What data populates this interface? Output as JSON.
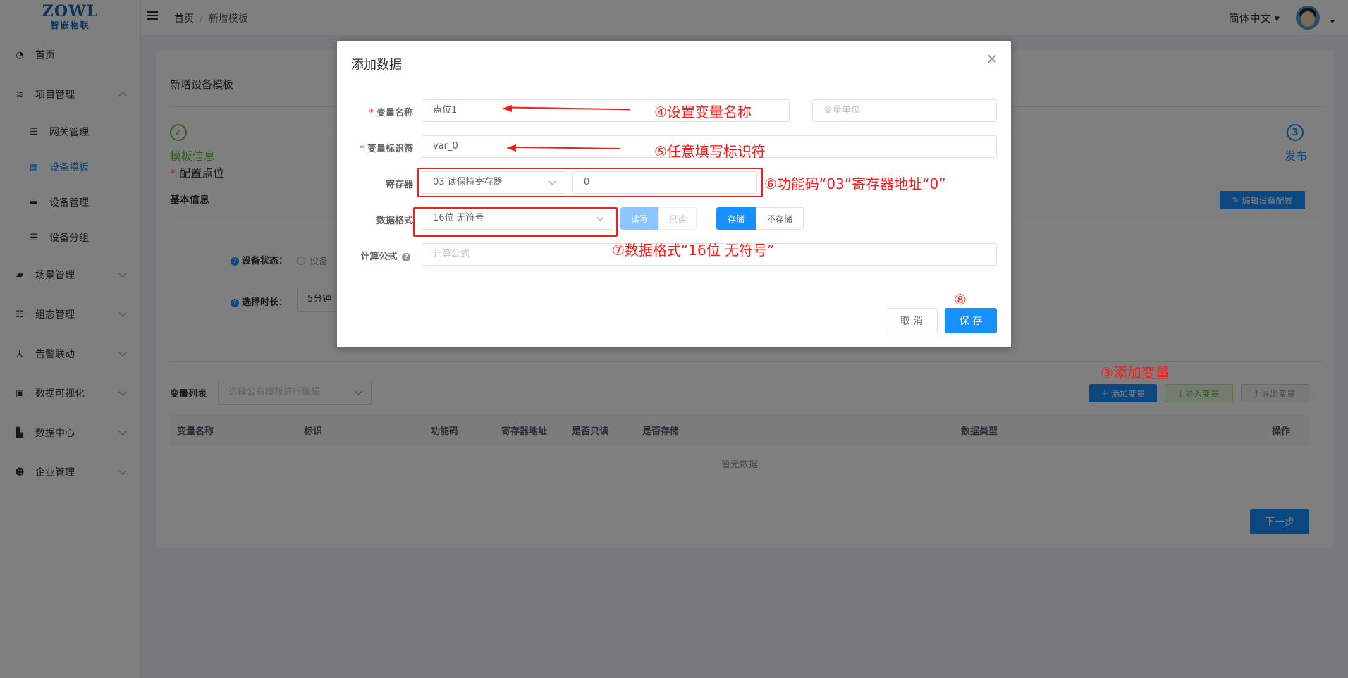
{
  "logo": {
    "brand": "ZOWL",
    "sub": "智嵌物联"
  },
  "sidebar": {
    "items": [
      {
        "label": "首页",
        "icon": "dashboard-icon"
      },
      {
        "label": "项目管理",
        "icon": "layers-icon"
      },
      {
        "label": "网关管理",
        "icon": "list-icon"
      },
      {
        "label": "设备模板",
        "icon": "grid-icon"
      },
      {
        "label": "设备管理",
        "icon": "server-icon"
      },
      {
        "label": "设备分组",
        "icon": "list-icon"
      },
      {
        "label": "场景管理",
        "icon": "clapper-icon"
      },
      {
        "label": "组态管理",
        "icon": "list-icon"
      },
      {
        "label": "告警联动",
        "icon": "share-icon"
      },
      {
        "label": "数据可视化",
        "icon": "monitor-icon"
      },
      {
        "label": "数据中心",
        "icon": "bar-chart-icon"
      },
      {
        "label": "企业管理",
        "icon": "user-gear-icon"
      }
    ]
  },
  "header": {
    "breadcrumb": [
      "首页",
      "新增模板"
    ],
    "language": "简体中文"
  },
  "main": {
    "title": "新增设备模板",
    "steps": [
      {
        "title": "模板信息",
        "status": "done"
      },
      {
        "title": "配置点位",
        "status": "current"
      },
      {
        "title": "发布",
        "index": "3",
        "status": "pending"
      }
    ],
    "basic_info": "基本信息",
    "edit_config": "编辑设备配置",
    "device_status_label": "设备状态：",
    "device_status_option": "设备",
    "duration_label": "选择时长：",
    "duration_value": "5分钟",
    "var_list_label": "变量列表",
    "public_template_placeholder": "选择公有模板进行编辑",
    "add_var": "添加变量",
    "import_var": "导入变量",
    "export_var": "导出变量",
    "table_columns": [
      "变量名称",
      "标识",
      "功能码",
      "寄存器地址",
      "是否只读",
      "是否存储",
      "数据类型",
      "操作"
    ],
    "empty_text": "暂无数据",
    "next_step": "下一步"
  },
  "dialog": {
    "title": "添加数据",
    "var_name_label": "变量名称",
    "var_name_value": "点位1",
    "var_unit_placeholder": "变量单位",
    "var_id_label": "变量标识符",
    "var_id_value": "var_0",
    "register_label": "寄存器",
    "register_func_value": "03 读保持寄存器",
    "register_addr_value": "0",
    "format_label": "数据格式",
    "format_value": "16位 无符号",
    "rw_options": [
      "读写",
      "只读"
    ],
    "store_options": [
      "存储",
      "不存储"
    ],
    "formula_label": "计算公式",
    "formula_placeholder": "计算公式",
    "cancel": "取 消",
    "save": "保 存"
  },
  "annotations": {
    "a3": "③添加变量",
    "a4": "④设置变量名称",
    "a5": "⑤任意填写标识符",
    "a6": "⑥功能码“03”寄存器地址“0”",
    "a7": "⑦数据格式“16位 无符号”",
    "a8": "⑧"
  },
  "colors": {
    "primary": "#1890ff",
    "success": "#67c23a",
    "annotation": "#ff1a1a"
  }
}
